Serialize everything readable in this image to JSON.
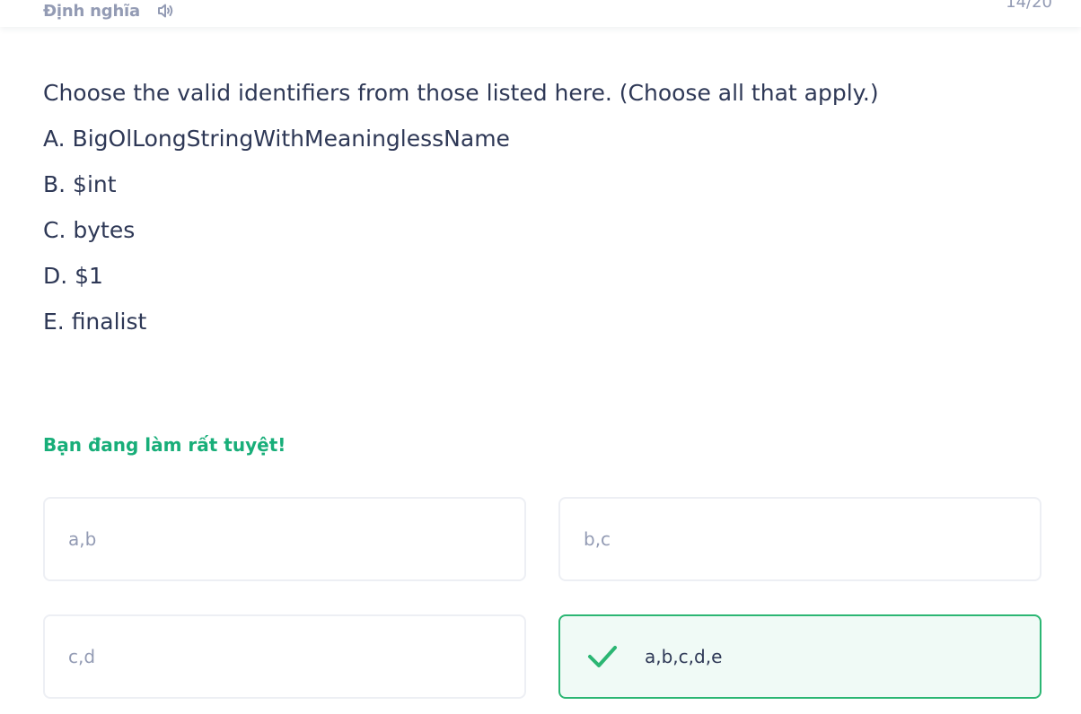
{
  "header": {
    "term_label": "Định nghĩa",
    "audio_icon": "speaker-icon",
    "counter": "14/20"
  },
  "question": {
    "prompt": "Choose the valid identifiers from those listed here. (Choose all that apply.)",
    "choices": [
      "A. BigOlLongStringWithMeaninglessName",
      "B. $int",
      "C. bytes",
      "D. $1",
      "E. finalist"
    ]
  },
  "feedback": {
    "message": "Bạn đang làm rất tuyệt!"
  },
  "answers": [
    {
      "label": "a,b",
      "state": "default"
    },
    {
      "label": "b,c",
      "state": "default"
    },
    {
      "label": "c,d",
      "state": "default"
    },
    {
      "label": "a,b,c,d,e",
      "state": "correct",
      "icon": "check-icon"
    }
  ],
  "colors": {
    "text_primary": "#2e3856",
    "text_muted": "#939bb4",
    "success": "#18ae79",
    "correct_border": "#2bb673",
    "correct_bg": "#f0faf6",
    "option_border": "#edeff4"
  }
}
